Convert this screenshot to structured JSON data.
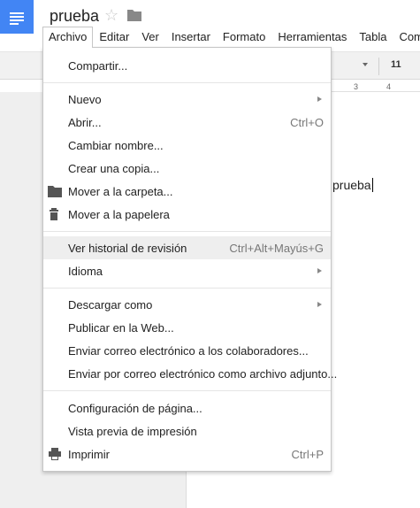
{
  "header": {
    "title": "prueba",
    "star_icon": "star-outline-icon",
    "folder_icon": "folder-icon"
  },
  "menubar": [
    {
      "label": "Archivo",
      "active": true
    },
    {
      "label": "Editar"
    },
    {
      "label": "Ver"
    },
    {
      "label": "Insertar"
    },
    {
      "label": "Formato"
    },
    {
      "label": "Herramientas"
    },
    {
      "label": "Tabla"
    },
    {
      "label": "Comple"
    }
  ],
  "toolbar": {
    "font_size": "11"
  },
  "ruler": {
    "ticks": [
      "3",
      "4"
    ]
  },
  "document": {
    "body_text": "prueba"
  },
  "file_menu": {
    "items": [
      {
        "label": "Compartir..."
      },
      {
        "label": "Nuevo",
        "submenu": true
      },
      {
        "label": "Abrir...",
        "shortcut": "Ctrl+O"
      },
      {
        "label": "Cambiar nombre..."
      },
      {
        "label": "Crear una copia..."
      },
      {
        "label": "Mover a la carpeta...",
        "icon": "folder-icon"
      },
      {
        "label": "Mover a la papelera",
        "icon": "trash-icon"
      },
      {
        "label": "Ver historial de revisión",
        "shortcut": "Ctrl+Alt+Mayús+G",
        "highlighted": true
      },
      {
        "label": "Idioma",
        "submenu": true
      },
      {
        "label": "Descargar como",
        "submenu": true
      },
      {
        "label": "Publicar en la Web..."
      },
      {
        "label": "Enviar correo electrónico a los colaboradores..."
      },
      {
        "label": "Enviar por correo electrónico como archivo adjunto..."
      },
      {
        "label": "Configuración de página..."
      },
      {
        "label": "Vista previa de impresión"
      },
      {
        "label": "Imprimir",
        "shortcut": "Ctrl+P",
        "icon": "printer-icon"
      }
    ]
  },
  "colors": {
    "brand_blue": "#4285f4",
    "menu_highlight": "#eeeeee"
  }
}
